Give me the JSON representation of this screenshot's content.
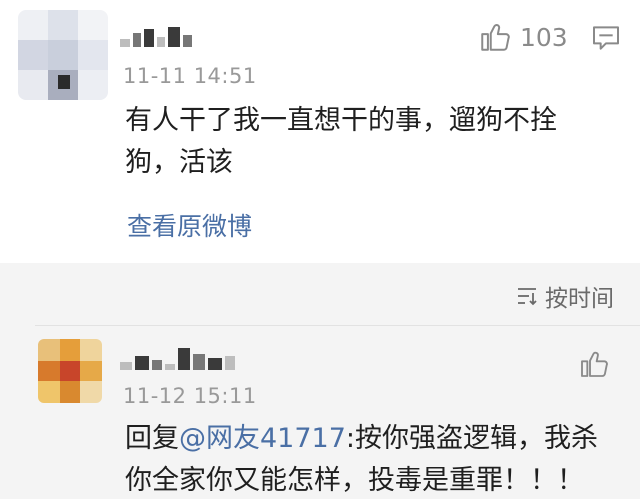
{
  "comments": [
    {
      "username": "",
      "timestamp": "11-11 14:51",
      "likes": "103",
      "text_line1": "有人干了我一直想干的事，遛狗不拴",
      "text_line2": "狗，活该",
      "view_weibo_label": "查看原微博"
    },
    {
      "username": "",
      "timestamp": "11-12 15:11",
      "reply_prefix": "回复",
      "mention": "@网友41717",
      "text_line1_rest": ":按你强盗逻辑，我杀",
      "text_line2": "你全家你又能怎样，投毒是重罪！！！"
    }
  ],
  "sort": {
    "label": "按时间"
  },
  "icons": {
    "like": "thumbs-up-icon",
    "comment": "comment-icon",
    "sort": "sort-icon"
  },
  "colors": {
    "link": "#4a6fa5",
    "timestamp": "#999999",
    "background_alt": "#f4f4f4"
  }
}
